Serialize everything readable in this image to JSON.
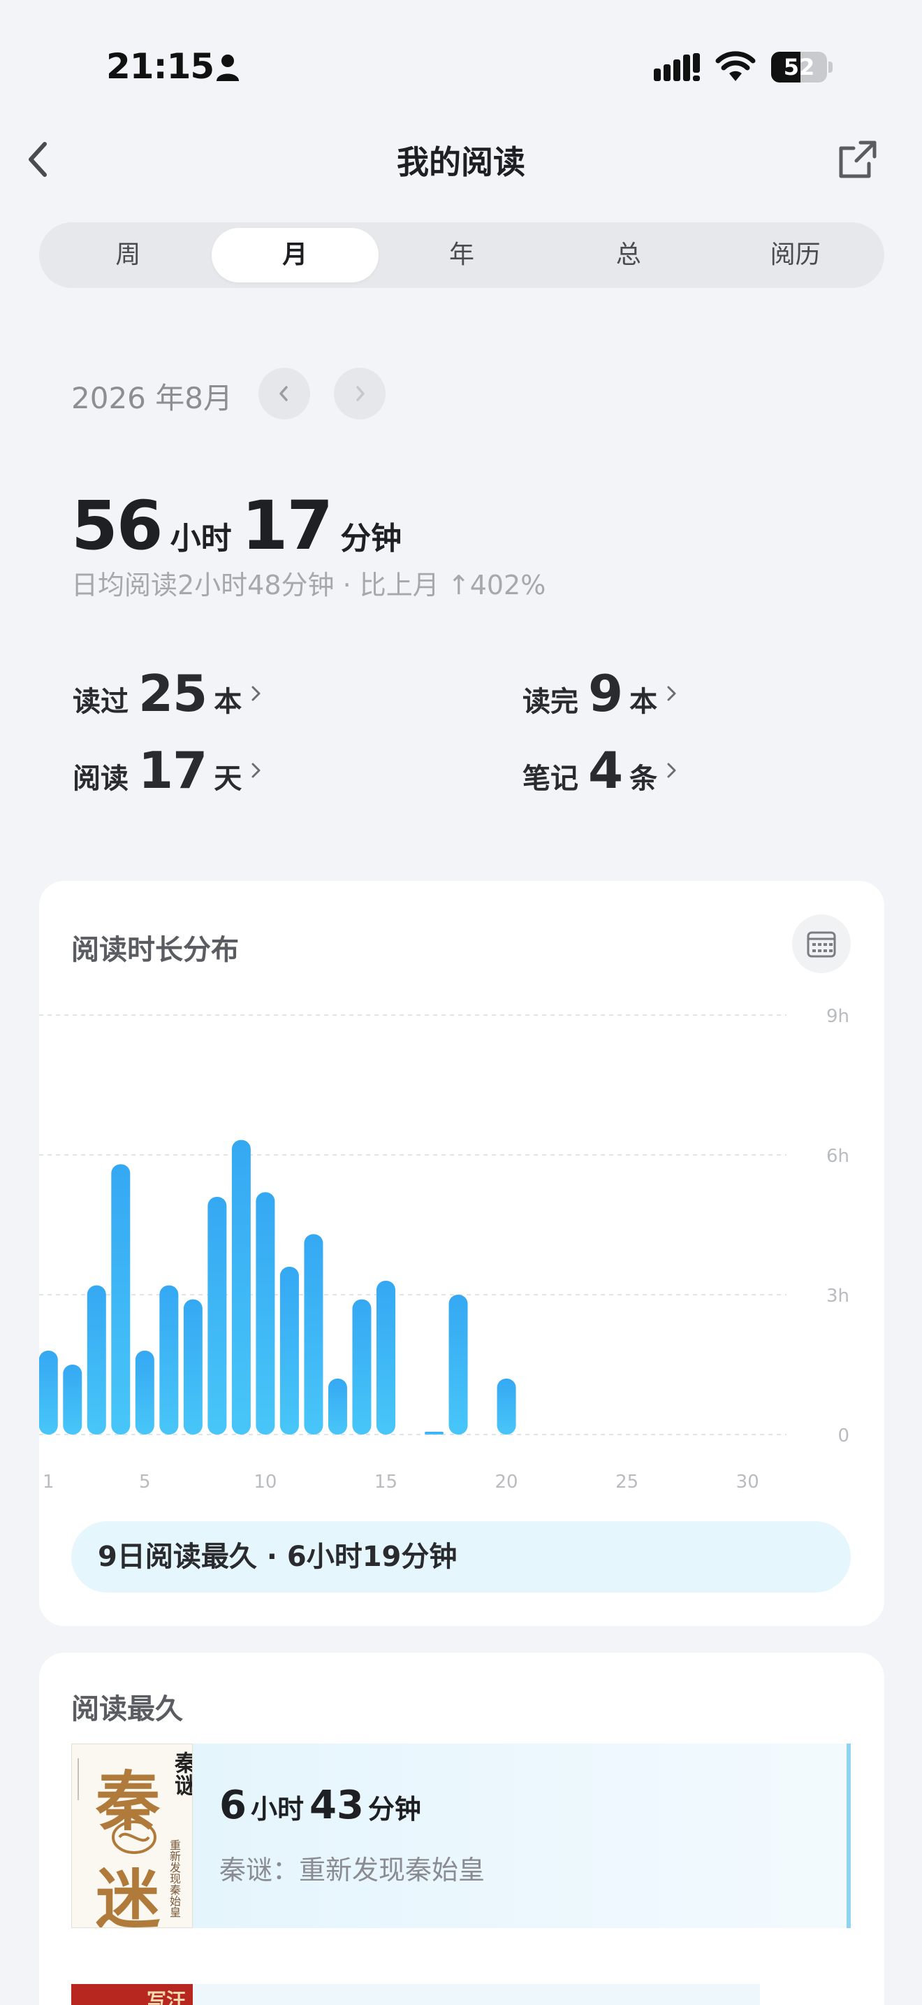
{
  "status_bar": {
    "time": "21:15",
    "battery": "52",
    "battery_level": 0.52,
    "icons": [
      "person-icon",
      "signal-icon",
      "wifi-icon",
      "battery-icon"
    ]
  },
  "header": {
    "title": "我的阅读",
    "back_icon": "chevron-left-icon",
    "share_icon": "share-icon"
  },
  "tabs": [
    {
      "label": "周",
      "active": false
    },
    {
      "label": "月",
      "active": true
    },
    {
      "label": "年",
      "active": false
    },
    {
      "label": "总",
      "active": false
    },
    {
      "label": "阅历",
      "active": false
    }
  ],
  "period": {
    "label": "2026 年8月"
  },
  "summary": {
    "hours": "56",
    "hours_unit": "小时",
    "minutes": "17",
    "minutes_unit": "分钟",
    "daily_text": "日均阅读2小时48分钟 · 比上月 ↑402%"
  },
  "stats": {
    "read": {
      "label": "读过",
      "value": "25",
      "unit": "本"
    },
    "finished": {
      "label": "读完",
      "value": "9",
      "unit": "本"
    },
    "days": {
      "label": "阅读",
      "value": "17",
      "unit": "天"
    },
    "notes": {
      "label": "笔记",
      "value": "4",
      "unit": "条"
    }
  },
  "distribution": {
    "title": "阅读时长分布",
    "best_day": "9日阅读最久 · 6小时19分钟"
  },
  "chart_data": {
    "type": "bar",
    "title": "阅读时长分布",
    "xlabel": "",
    "ylabel": "",
    "x_ticks": [
      "1",
      "5",
      "10",
      "15",
      "20",
      "25",
      "30"
    ],
    "y_ticks": [
      "0",
      "3h",
      "6h",
      "9h"
    ],
    "ylim": [
      0,
      9
    ],
    "y_unit": "hours",
    "categories": [
      1,
      2,
      3,
      4,
      5,
      6,
      7,
      8,
      9,
      10,
      11,
      12,
      13,
      14,
      15,
      16,
      17,
      18,
      19,
      20,
      21,
      22,
      23,
      24,
      25,
      26,
      27,
      28,
      29,
      30,
      31
    ],
    "values": [
      1.8,
      1.5,
      3.2,
      5.8,
      1.8,
      3.2,
      2.9,
      5.1,
      6.32,
      5.2,
      3.6,
      4.3,
      1.2,
      2.9,
      3.3,
      0,
      0.05,
      3.0,
      0,
      1.2,
      0,
      0,
      0,
      0,
      0,
      0,
      0,
      0,
      0,
      0,
      0
    ],
    "color": "#3fb4f6",
    "grid": true,
    "legend": "none"
  },
  "longest": {
    "title": "阅读最久",
    "books": [
      {
        "hours": "6",
        "hours_unit": "小时",
        "minutes": "43",
        "minutes_unit": "分钟",
        "name": "秦谜：重新发现秦始皇",
        "cover_title_top": "秦谜",
        "cover_big_1": "秦",
        "cover_big_2": "迷",
        "cover_subtitle": "重新发现秦始皇"
      },
      {
        "cover_title_top": "写汪"
      }
    ]
  },
  "colors": {
    "background": "#f3f4f7",
    "bar": "#3fb4f6",
    "highlight": "#e6f6fd",
    "cover_brown": "#b07a3a"
  }
}
